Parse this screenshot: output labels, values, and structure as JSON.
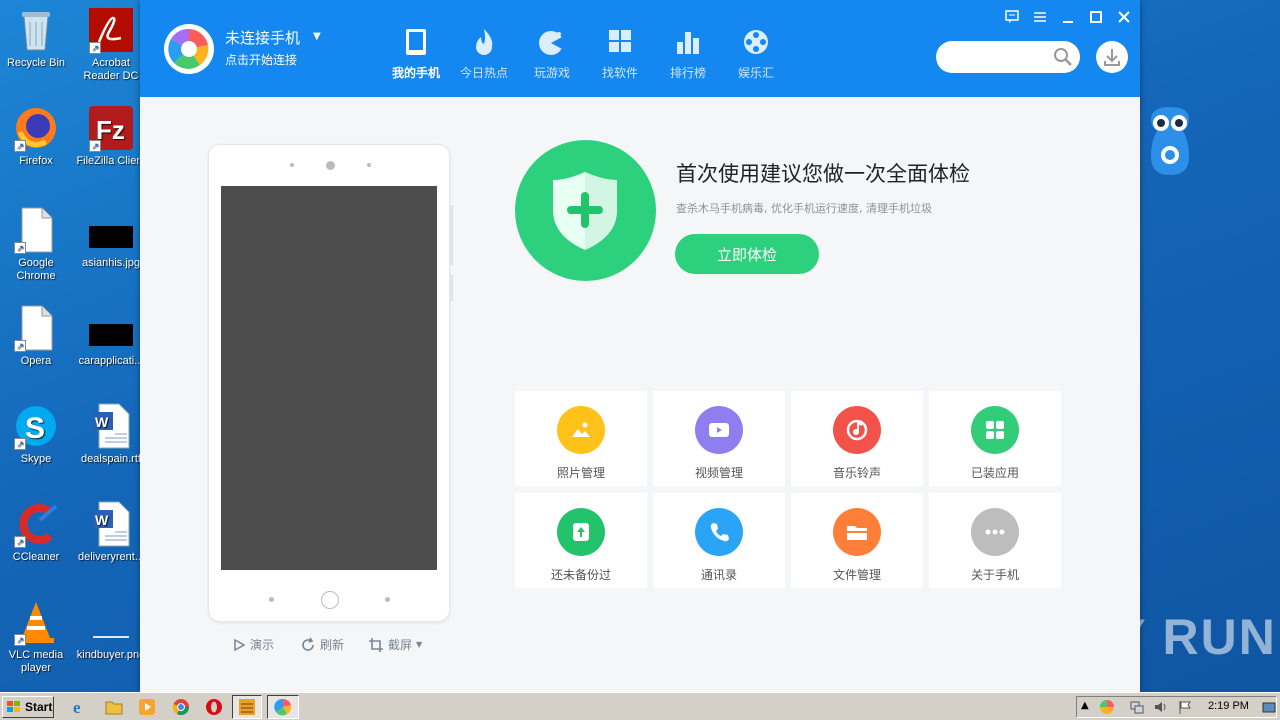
{
  "desktop": {
    "icons": [
      {
        "label": "Recycle Bin"
      },
      {
        "label": "Acrobat Reader DC"
      },
      {
        "label": "Firefox"
      },
      {
        "label": "FileZilla Client"
      },
      {
        "label": "Google Chrome"
      },
      {
        "label": "asianhis.jpg"
      },
      {
        "label": "Opera"
      },
      {
        "label": "carapplicati..."
      },
      {
        "label": "Skype"
      },
      {
        "label": "dealspain.rtf"
      },
      {
        "label": "CCleaner"
      },
      {
        "label": "deliveryrent..."
      },
      {
        "label": "VLC media player"
      },
      {
        "label": "kindbuyer.png"
      }
    ],
    "watermark": "ANY RUN"
  },
  "app": {
    "connection": {
      "title": "未连接手机",
      "subtitle": "点击开始连接"
    },
    "nav": [
      {
        "label": "我的手机",
        "icon": "phone-icon",
        "active": true
      },
      {
        "label": "今日热点",
        "icon": "flame-icon"
      },
      {
        "label": "玩游戏",
        "icon": "gamepad-icon"
      },
      {
        "label": "找软件",
        "icon": "apps-grid-icon"
      },
      {
        "label": "排行榜",
        "icon": "bar-chart-icon"
      },
      {
        "label": "娱乐汇",
        "icon": "film-reel-icon"
      }
    ],
    "search": {
      "placeholder": "",
      "value": ""
    },
    "phone_actions": [
      {
        "label": "演示",
        "icon": "play-icon"
      },
      {
        "label": "刷新",
        "icon": "refresh-icon"
      },
      {
        "label": "截屏",
        "icon": "crop-icon"
      }
    ],
    "checkup": {
      "title": "首次使用建议您做一次全面体检",
      "subtitle": "查杀木马手机病毒, 优化手机运行速度, 清理手机垃圾",
      "button": "立即体检"
    },
    "tiles": [
      {
        "label": "照片管理",
        "icon": "photo-icon",
        "color": "#ffc21a"
      },
      {
        "label": "视频管理",
        "icon": "video-icon",
        "color": "#8f7ef0"
      },
      {
        "label": "音乐铃声",
        "icon": "music-icon",
        "color": "#f2524a"
      },
      {
        "label": "已装应用",
        "icon": "apps-icon",
        "color": "#33cd7a"
      },
      {
        "label": "还未备份过",
        "icon": "backup-icon",
        "color": "#22c36b"
      },
      {
        "label": "通讯录",
        "icon": "contacts-phone-icon",
        "color": "#2ba4f5"
      },
      {
        "label": "文件管理",
        "icon": "folder-icon",
        "color": "#ff7f3a"
      },
      {
        "label": "关于手机",
        "icon": "more-icon",
        "color": "#bdbdbd"
      }
    ],
    "colors": {
      "header": "#1487f0",
      "accent_green": "#2dd07c"
    }
  },
  "taskbar": {
    "start_label": "Start",
    "clock": "2:19 PM"
  }
}
